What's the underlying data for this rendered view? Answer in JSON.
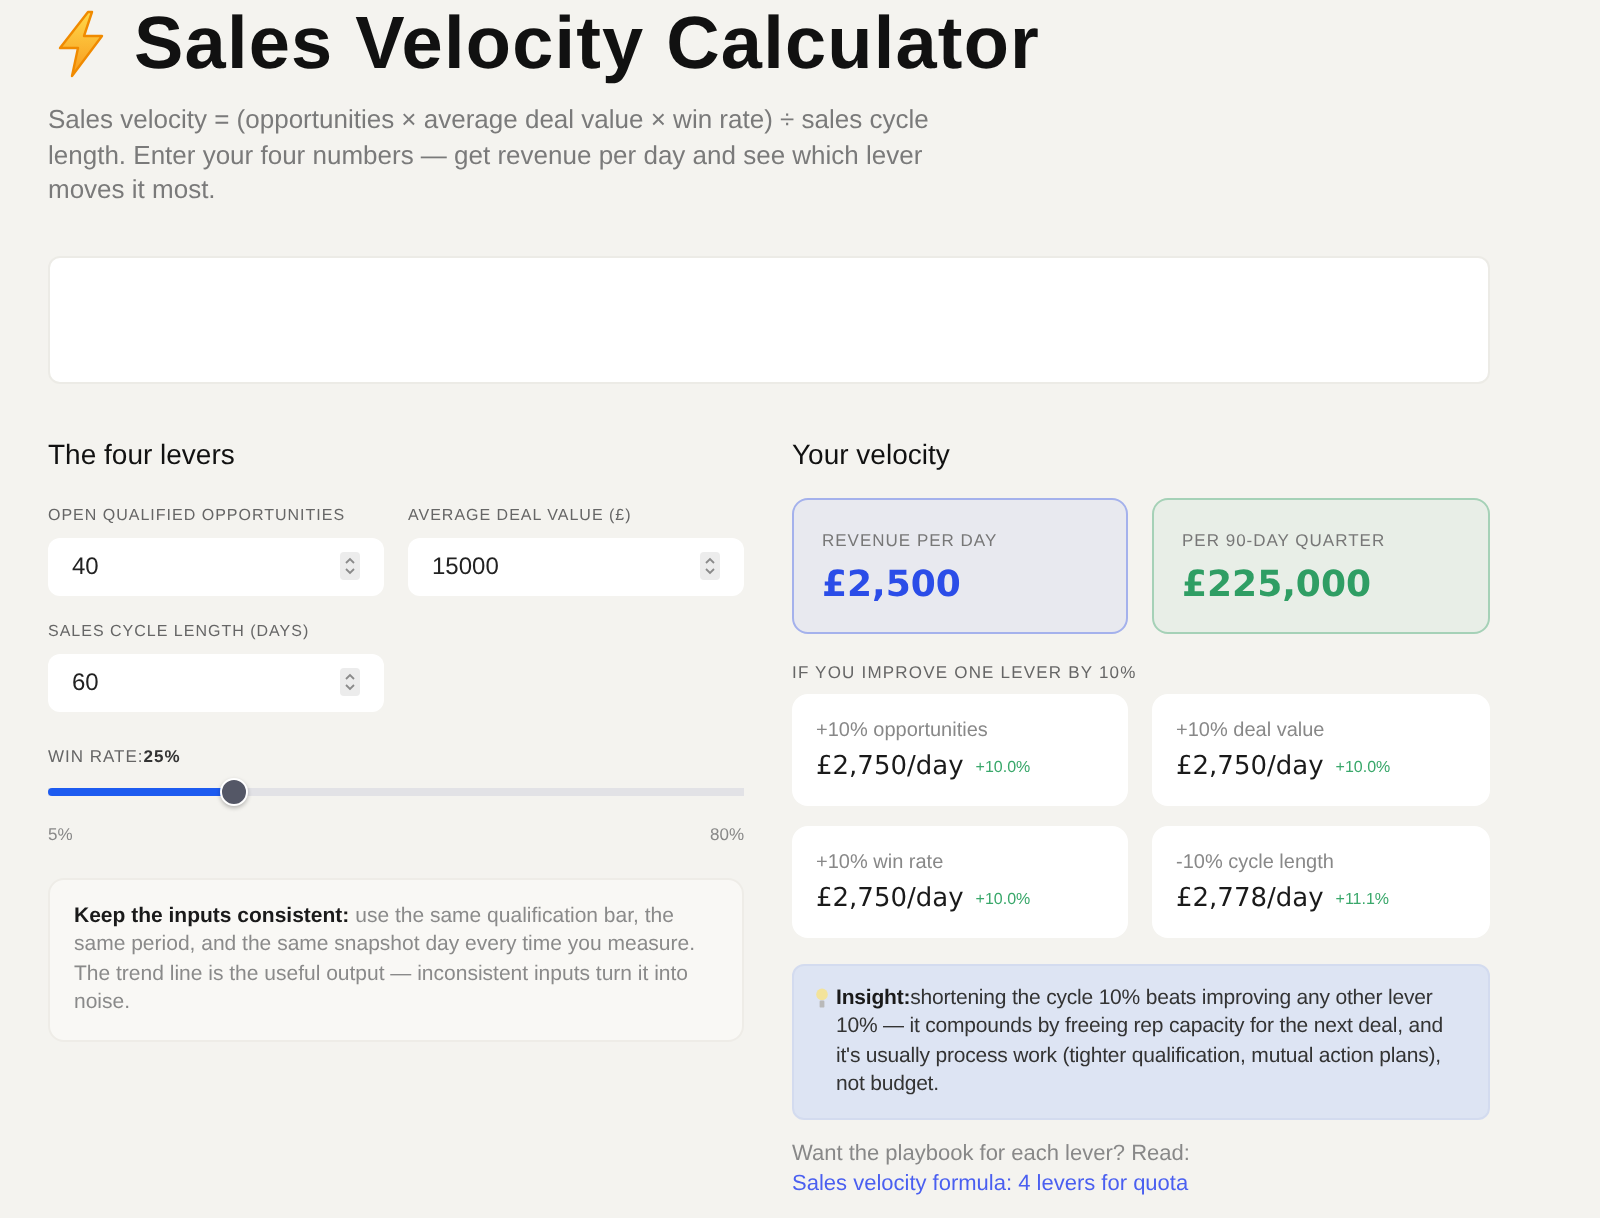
{
  "header": {
    "title": "Sales Velocity Calculator",
    "intro": "Sales velocity = (opportunities × average deal value × win rate) ÷ sales cycle length. Enter your four numbers — get revenue per day and see which lever moves it most."
  },
  "levers": {
    "heading": "The four levers",
    "inputs": [
      {
        "label": "OPEN QUALIFIED OPPORTUNITIES",
        "value": "40"
      },
      {
        "label": "AVERAGE DEAL VALUE (£)",
        "value": "15000"
      },
      {
        "label": "SALES CYCLE LENGTH (DAYS)",
        "value": "60"
      }
    ],
    "win_rate": {
      "label": "WIN RATE:",
      "reading": "25%",
      "level": 0.267,
      "min_label": "5%",
      "max_label": "80%"
    },
    "note": "**Keep the inputs consistent:** use the same qualification bar, the same period, and the same snapshot day every time you measure. The trend line is the useful output — inconsistent inputs turn it into noise."
  },
  "velocity": {
    "heading": "Your velocity",
    "metrics": [
      {
        "label": "REVENUE PER DAY",
        "value": "£2,500",
        "color": "#2b4de8"
      },
      {
        "label": "PER 90-DAY QUARTER",
        "value": "£225,000",
        "color": "#2f9e64"
      }
    ],
    "scenarios_heading": "IF YOU IMPROVE ONE LEVER BY 10%",
    "scenarios": [
      {
        "label": "+10% opportunities",
        "value": "£2,750/day",
        "change": "+10.0%"
      },
      {
        "label": "+10% deal value",
        "value": "£2,750/day",
        "change": "+10.0%"
      },
      {
        "label": "+10% win rate",
        "value": "£2,750/day",
        "change": "+10.0%"
      },
      {
        "label": "-10% cycle length",
        "value": "£2,778/day",
        "change": "+11.1%"
      }
    ],
    "insight": "**Insight:**shortening the cycle 10% beats improving any other lever 10% — it compounds by freeing rep capacity for the next deal, and it's usually process work (tighter qualification, mutual action plans), not budget.",
    "footer": {
      "text": "Want the playbook for each lever? Read:",
      "link": "Sales velocity formula: 4 levers for quota"
    }
  }
}
